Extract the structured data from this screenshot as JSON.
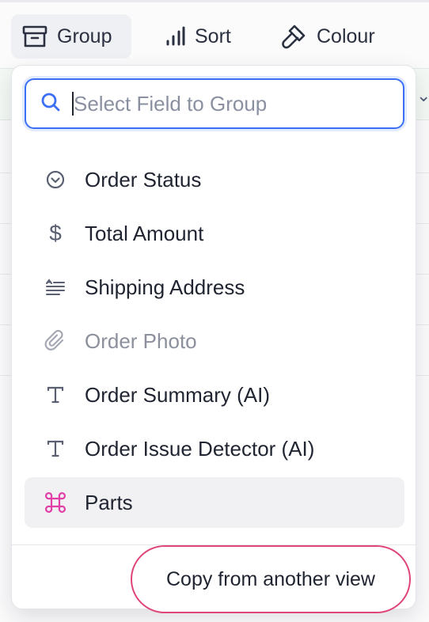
{
  "toolbar": {
    "group_label": "Group",
    "sort_label": "Sort",
    "colour_label": "Colour"
  },
  "search": {
    "placeholder": "Select Field to Group",
    "value": ""
  },
  "fields": [
    {
      "label": "Order Status",
      "icon": "status-check-icon"
    },
    {
      "label": "Total Amount",
      "icon": "dollar-icon"
    },
    {
      "label": "Shipping Address",
      "icon": "long-text-icon"
    },
    {
      "label": "Order Photo",
      "icon": "paperclip-icon",
      "disabled": true
    },
    {
      "label": "Order Summary (AI)",
      "icon": "text-icon"
    },
    {
      "label": "Order Issue Detector (AI)",
      "icon": "text-icon"
    },
    {
      "label": "Parts",
      "icon": "link-records-icon",
      "highlighted": true
    }
  ],
  "footer": {
    "copy_label": "Copy from another view"
  },
  "colors": {
    "accent_blue": "#3b6ff5",
    "highlight_pink": "#e0457a",
    "parts_icon": "#e23ea8"
  }
}
